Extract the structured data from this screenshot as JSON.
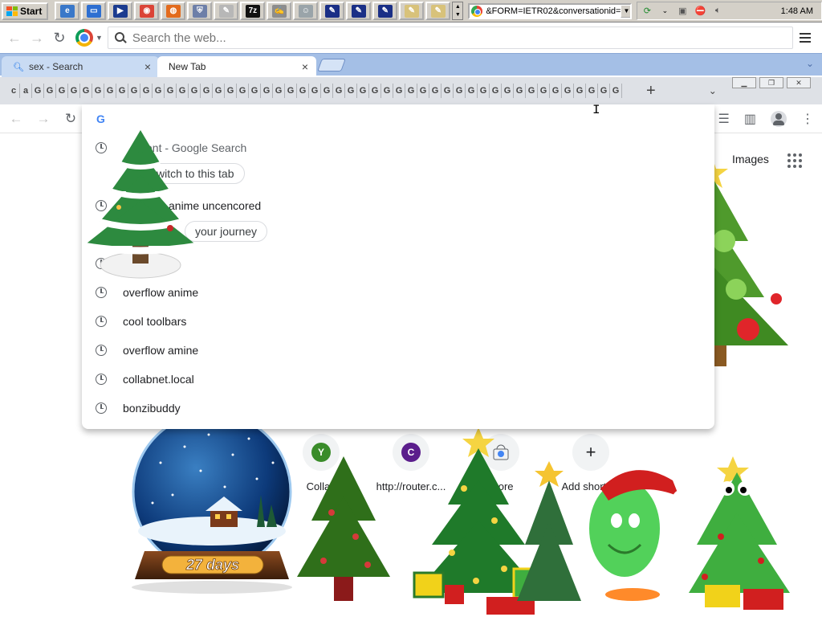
{
  "taskbar": {
    "start_label": "Start",
    "quick_launch": [
      {
        "icon": "ie-icon",
        "color": "#3a78c9",
        "glyph": "e"
      },
      {
        "icon": "explorer-icon",
        "color": "#2e6fd1",
        "glyph": "▭"
      },
      {
        "icon": "media-icon",
        "color": "#1c3c8f",
        "glyph": "▶"
      },
      {
        "icon": "chrome-icon",
        "color": "#db4437",
        "glyph": "◉"
      },
      {
        "icon": "firefox-icon",
        "color": "#e36b1d",
        "glyph": "◍"
      },
      {
        "icon": "shield-icon",
        "color": "#6d7fa8",
        "glyph": "⛨"
      },
      {
        "icon": "paint-icon",
        "color": "#b7b7b7",
        "glyph": "✎"
      },
      {
        "icon": "7zip-icon",
        "color": "#111111",
        "glyph": "7z"
      },
      {
        "icon": "notepad-icon",
        "color": "#8d8d8d",
        "glyph": "✍"
      },
      {
        "icon": "people-icon",
        "color": "#9aa4a9",
        "glyph": "☺"
      },
      {
        "icon": "notes-icon-1",
        "color": "#1a2f86",
        "glyph": "✎"
      },
      {
        "icon": "notes-icon-2",
        "color": "#1a2f86",
        "glyph": "✎"
      },
      {
        "icon": "notes-icon-3",
        "color": "#1a2f86",
        "glyph": "✎"
      },
      {
        "icon": "notes-icon-4",
        "color": "#d8c27a",
        "glyph": "✎"
      },
      {
        "icon": "notes-icon-5",
        "color": "#d8c27a",
        "glyph": "✎"
      }
    ],
    "address_value": "&FORM=IETR02&conversationid=",
    "clock": "1:48 AM"
  },
  "outer_toolbar": {
    "search_placeholder": "Search the web..."
  },
  "tabs": [
    {
      "label": "sex - Search",
      "close": "×",
      "icon": "search-icon"
    },
    {
      "label": "New Tab",
      "close": "×"
    }
  ],
  "inner_tabstrip": {
    "mini_tabs": [
      "c",
      "a",
      "G",
      "G",
      "G",
      "G",
      "G",
      "G",
      "G",
      "G",
      "G",
      "G",
      "G",
      "G",
      "G",
      "G",
      "G",
      "G",
      "G",
      "G",
      "G",
      "G",
      "G",
      "G",
      "G",
      "G",
      "G",
      "G",
      "G",
      "G",
      "G",
      "G",
      "G",
      "G",
      "G",
      "G",
      "G",
      "G",
      "G",
      "G",
      "G",
      "G",
      "G",
      "G",
      "G",
      "G",
      "G",
      "G",
      "G",
      "G",
      "G"
    ],
    "plus": "+",
    "down": "⌄"
  },
  "suggestions": [
    {
      "text": "ent - Google Search",
      "kind": "history"
    },
    {
      "text": "witch to this tab",
      "kind": "chip"
    },
    {
      "text": "anime uncencored",
      "kind": "history"
    },
    {
      "text": "your journey",
      "kind": "chip"
    },
    {
      "text": "",
      "kind": "history"
    },
    {
      "text": "overflow anime",
      "kind": "history"
    },
    {
      "text": "cool toolbars",
      "kind": "history"
    },
    {
      "text": "overflow amine",
      "kind": "history"
    },
    {
      "text": "collabnet.local",
      "kind": "history"
    },
    {
      "text": "bonzibuddy",
      "kind": "history"
    }
  ],
  "ntp": {
    "images_link": "Images",
    "shortcuts": [
      {
        "label": "Collab",
        "letter": "Y",
        "color": "#3a8c2a"
      },
      {
        "label": "http://router.c...",
        "letter": "C",
        "color": "#5b1e8c"
      },
      {
        "label": "Store",
        "letter": "",
        "color": "#ffffff"
      },
      {
        "label": "Add shortcut",
        "letter": "+",
        "color": "#f1f3f4"
      }
    ]
  },
  "decorations": {
    "snowglobe_text": "27 days"
  }
}
